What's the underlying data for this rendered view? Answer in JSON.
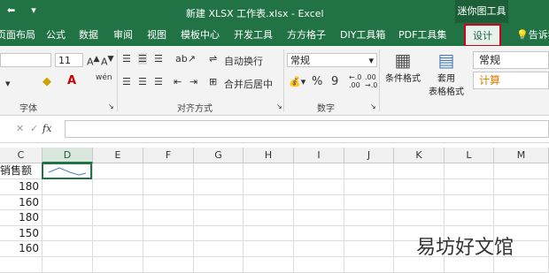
{
  "title_bar": {
    "quick_access": [
      "⬅",
      "▾"
    ],
    "title": "新建 XLSX 工作表.xlsx - Excel",
    "context_group": "迷你图工具"
  },
  "tabs": [
    {
      "label": "页面布局"
    },
    {
      "label": "公式"
    },
    {
      "label": "数据"
    },
    {
      "label": "审阅"
    },
    {
      "label": "视图"
    },
    {
      "label": "模板中心"
    },
    {
      "label": "开发工具"
    },
    {
      "label": "方方格子"
    },
    {
      "label": "DIY工具箱"
    },
    {
      "label": "PDF工具集"
    },
    {
      "label": "设计",
      "active": true
    },
    {
      "label": "告诉我"
    }
  ],
  "ribbon": {
    "font": {
      "size": "11",
      "group_label": "字体"
    },
    "alignment": {
      "wrap_text": "自动换行",
      "merge_center": "合并后居中",
      "group_label": "对齐方式"
    },
    "number": {
      "format": "常规",
      "percent": "%",
      "comma": "9",
      "group_label": "数字"
    },
    "styles": {
      "conditional": "条件格式",
      "table_format_1": "套用",
      "table_format_2": "表格格式",
      "style_normal": "常规",
      "style_calc": "计算"
    }
  },
  "formula_bar": {
    "fx": "fx",
    "check": "✓"
  },
  "columns": [
    "C",
    "D",
    "E",
    "F",
    "G",
    "H",
    "I",
    "J",
    "K",
    "L",
    "M"
  ],
  "selected_column": "D",
  "cells": {
    "header": "销售额",
    "values": [
      "180",
      "160",
      "180",
      "150",
      "160"
    ]
  },
  "watermark": "易坊好文馆",
  "colors": {
    "excel_green": "#217346",
    "highlight_red": "#d0021b",
    "calc_orange": "#e07b00"
  }
}
